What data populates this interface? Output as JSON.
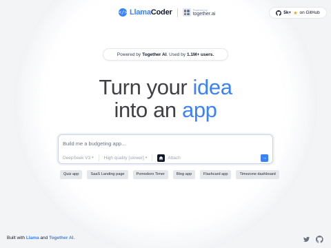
{
  "header": {
    "brand_llama": "Llama",
    "brand_coder": "Coder",
    "partner_sub": "Powered by",
    "partner_name": "together.ai",
    "github": {
      "count": "5k+",
      "suffix": "on GitHub"
    }
  },
  "banner": {
    "prefix": "Powered by",
    "company": "Together AI",
    "middle": ". Used by",
    "users": "1.1M+ users."
  },
  "hero": {
    "line1_a": "Turn your ",
    "line1_hl": "idea",
    "line2_a": "into an ",
    "line2_hl": "app"
  },
  "prompt": {
    "placeholder": "Build me a budgeting app...",
    "model": "DeepSeek V3",
    "quality": "High quality [slower]",
    "attach": "Attach"
  },
  "suggestions": [
    "Quiz app",
    "SaaS Landing page",
    "Pomodoro Timer",
    "Blog app",
    "Flashcard app",
    "Timezone dashboard"
  ],
  "footer": {
    "prefix": "Built with ",
    "llama": "Llama",
    "and": " and ",
    "together": "Together AI",
    "dot": "."
  },
  "colors": {
    "accent": "#3b82f6",
    "star": "#f59e0b"
  },
  "icons": [
    "llamacoder-logo-icon",
    "together-logo-icon",
    "github-icon",
    "star-icon",
    "chevron-down-icon",
    "house-icon",
    "arrow-right-icon",
    "twitter-icon"
  ]
}
